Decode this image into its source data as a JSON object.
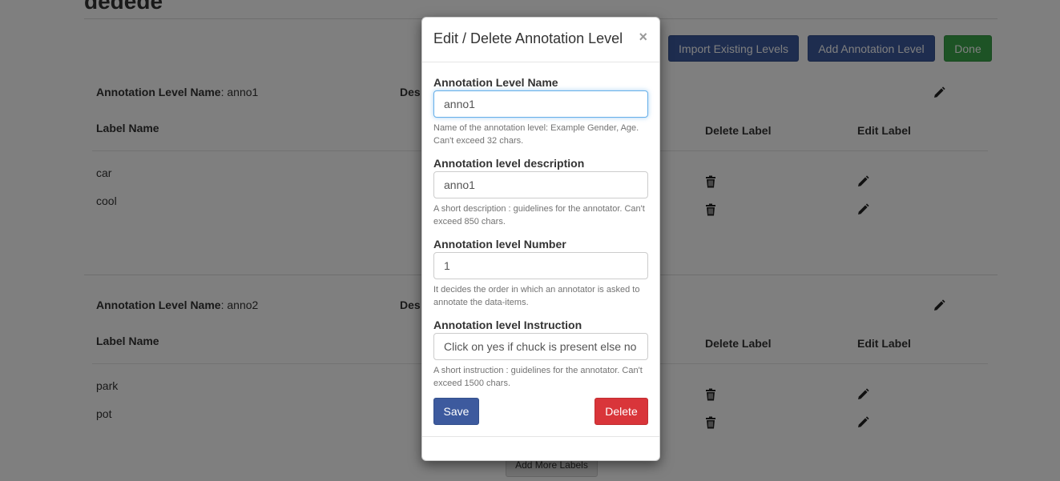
{
  "page": {
    "title": "dedede"
  },
  "toolbar": {
    "import_label": "Import Existing Levels",
    "add_label": "Add Annotation Level",
    "done_label": "Done"
  },
  "levels": [
    {
      "name_key": "Annotation Level Name",
      "name_value": ": anno1",
      "desc_key": "Des",
      "columns": {
        "label_name": "Label Name",
        "delete_label": "Delete Label",
        "edit_label": "Edit Label"
      },
      "labels": [
        "car",
        "cool"
      ]
    },
    {
      "name_key": "Annotation Level Name",
      "name_value": ": anno2",
      "desc_key": "Des",
      "columns": {
        "label_name": "Label Name",
        "delete_label": "Delete Label",
        "edit_label": "Edit Label"
      },
      "labels": [
        "park",
        "pot"
      ]
    }
  ],
  "add_more_label": "Add More Labels",
  "modal": {
    "title": "Edit / Delete Annotation Level",
    "close": "×",
    "fields": [
      {
        "label": "Annotation Level Name",
        "value": "anno1",
        "help": "Name of the annotation level: Example Gender, Age. Can't exceed 32 chars."
      },
      {
        "label": "Annotation level description",
        "value": "anno1",
        "help": "A short description : guidelines for the annotator. Can't exceed 850 chars."
      },
      {
        "label": "Annotation level Number",
        "value": "1",
        "help": "It decides the order in which an annotator is asked to annotate the data-items."
      },
      {
        "label": "Annotation level Instruction",
        "value": "Click on yes if chuck is present else no",
        "help": "A short instruction : guidelines for the annotator. Can't exceed 1500 chars."
      }
    ],
    "save_label": "Save",
    "delete_label": "Delete"
  },
  "colors": {
    "primary": "#3d5a9e",
    "success": "#3aa64a",
    "danger": "#d9353a",
    "overlay": "rgba(0,0,0,0.5)"
  },
  "icons": {
    "edit": "pencil-icon",
    "delete": "trash-icon",
    "close": "close-icon"
  }
}
